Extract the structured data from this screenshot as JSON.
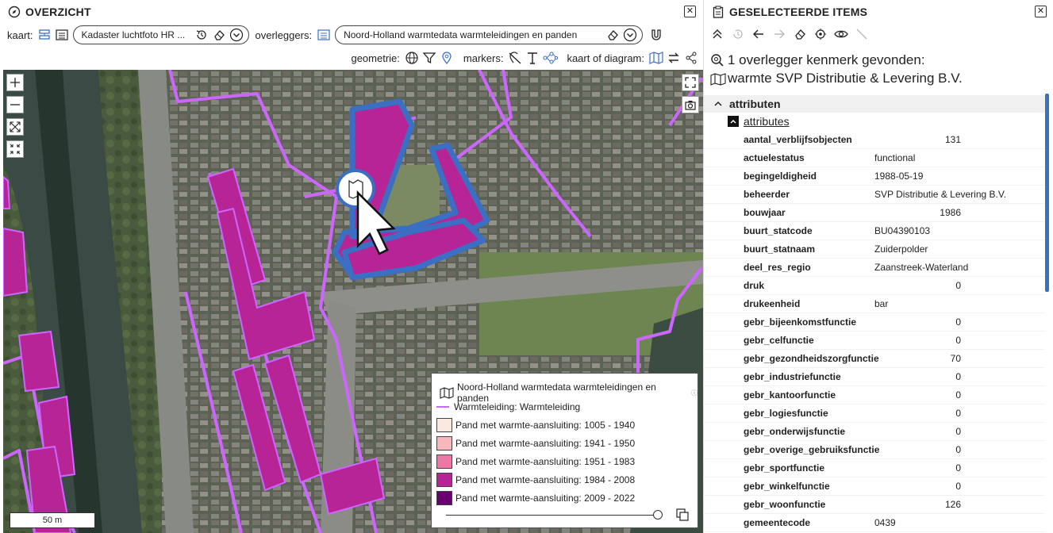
{
  "overview": {
    "title": "OVERZICHT",
    "kaart_label": "kaart:",
    "kaart_value": "Kadaster luchtfoto HR ...",
    "overleggers_label": "overleggers:",
    "overleggers_value": "Noord-Holland warmtedata warmteleidingen en panden",
    "geometrie_label": "geometrie:",
    "markers_label": "markers:",
    "kaart_diagram_label": "kaart of diagram:"
  },
  "map": {
    "scale_label": "50 m"
  },
  "legend": {
    "title": "Noord-Holland warmtedata warmteleidingen en panden",
    "line_label": "Warmteleiding: Warmteleiding",
    "items": [
      {
        "label": "Pand met warmte-aansluiting: 1005 - 1940",
        "color": "#fbe8de"
      },
      {
        "label": "Pand met warmte-aansluiting: 1941 - 1950",
        "color": "#f6b7bd"
      },
      {
        "label": "Pand met warmte-aansluiting: 1951 - 1983",
        "color": "#ee76a7"
      },
      {
        "label": "Pand met warmte-aansluiting: 1984 - 2008",
        "color": "#b72496"
      },
      {
        "label": "Pand met warmte-aansluiting: 2009 - 2022",
        "color": "#6a006f"
      }
    ]
  },
  "selected": {
    "title": "GESELECTEERDE ITEMS",
    "found_line1": "1 overlegger kenmerk gevonden:",
    "found_line2": "warmte SVP Distributie & Levering B.V.",
    "section": "attributen",
    "subsection": "attributes",
    "attributes": [
      {
        "key": "aantal_verblijfsobjecten",
        "value": "131",
        "num": true
      },
      {
        "key": "actuelestatus",
        "value": "functional",
        "num": false
      },
      {
        "key": "begingeldigheid",
        "value": "1988-05-19",
        "num": false
      },
      {
        "key": "beheerder",
        "value": "SVP Distributie & Levering B.V.",
        "num": false
      },
      {
        "key": "bouwjaar",
        "value": "1986",
        "num": true
      },
      {
        "key": "buurt_statcode",
        "value": "BU04390103",
        "num": false
      },
      {
        "key": "buurt_statnaam",
        "value": "Zuiderpolder",
        "num": false
      },
      {
        "key": "deel_res_regio",
        "value": "Zaanstreek-Waterland",
        "num": false
      },
      {
        "key": "druk",
        "value": "0",
        "num": true
      },
      {
        "key": "drukeenheid",
        "value": "bar",
        "num": false
      },
      {
        "key": "gebr_bijeenkomstfunctie",
        "value": "0",
        "num": true
      },
      {
        "key": "gebr_celfunctie",
        "value": "0",
        "num": true
      },
      {
        "key": "gebr_gezondheidszorgfunctie",
        "value": "70",
        "num": true
      },
      {
        "key": "gebr_industriefunctie",
        "value": "0",
        "num": true
      },
      {
        "key": "gebr_kantoorfunctie",
        "value": "0",
        "num": true
      },
      {
        "key": "gebr_logiesfunctie",
        "value": "0",
        "num": true
      },
      {
        "key": "gebr_onderwijsfunctie",
        "value": "0",
        "num": true
      },
      {
        "key": "gebr_overige_gebruiksfunctie",
        "value": "0",
        "num": true
      },
      {
        "key": "gebr_sportfunctie",
        "value": "0",
        "num": true
      },
      {
        "key": "gebr_winkelfunctie",
        "value": "0",
        "num": true
      },
      {
        "key": "gebr_woonfunctie",
        "value": "126",
        "num": true
      },
      {
        "key": "gemeentecode",
        "value": "0439",
        "num": false
      }
    ]
  },
  "colors": {
    "pipe": "#cc66ff",
    "building": "#b72496",
    "selection": "#3a6fc4"
  }
}
